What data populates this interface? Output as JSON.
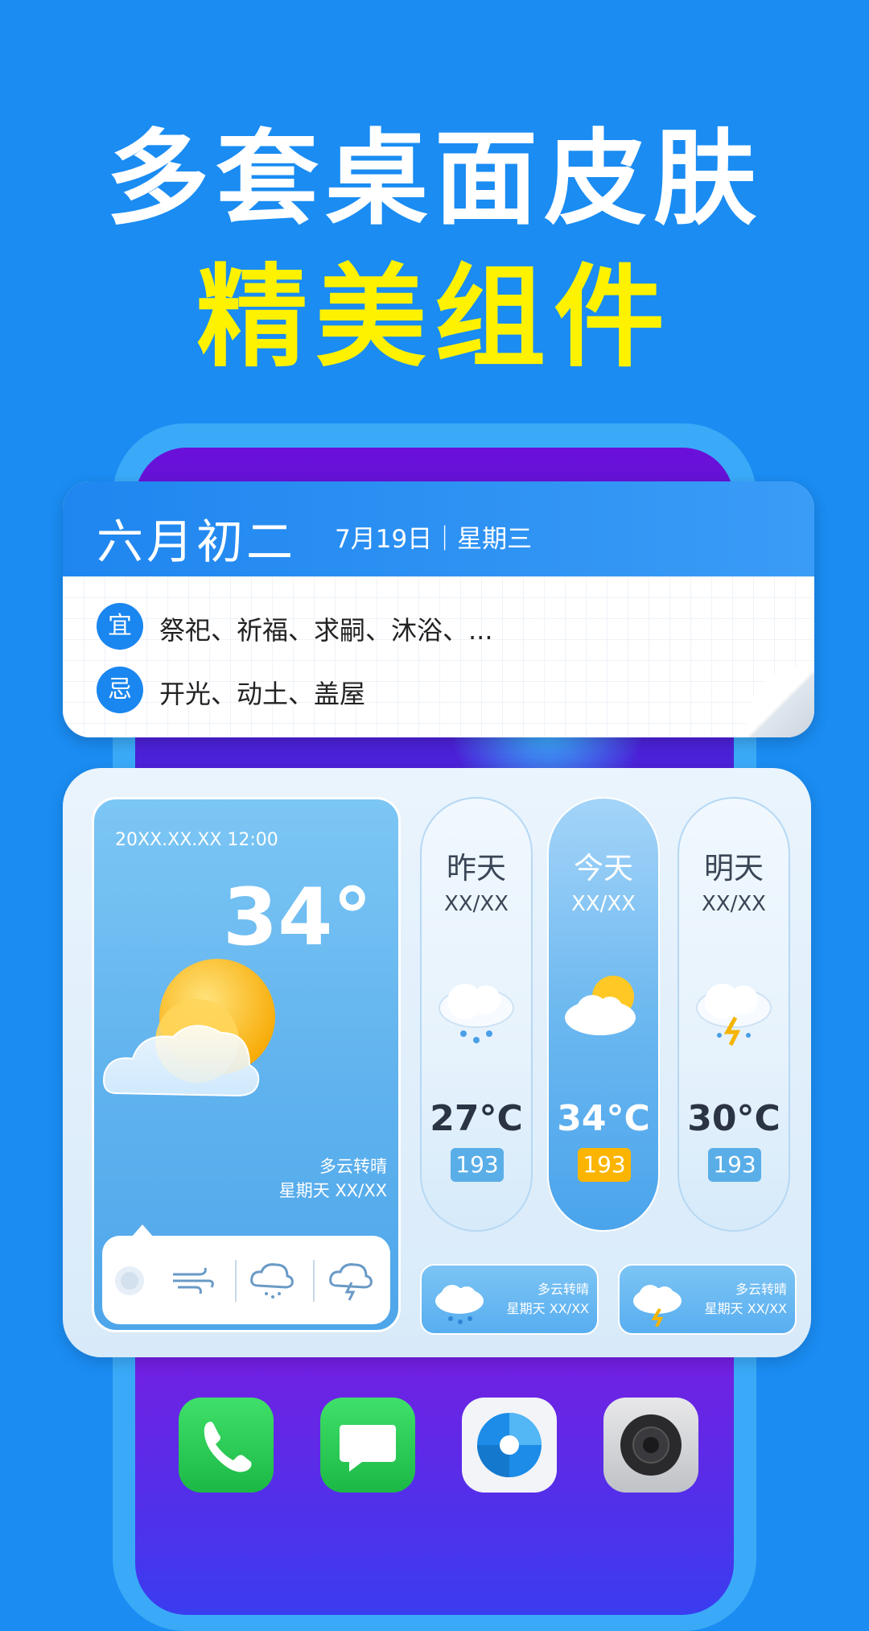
{
  "headline": {
    "line1": "多套桌面皮肤",
    "line2": "精美组件"
  },
  "calendar": {
    "lunar_date": "六月初二",
    "solar_date": "7月19日｜星期三",
    "good": {
      "badge": "宜",
      "text": "祭祀、祈福、求嗣、沐浴、..."
    },
    "bad": {
      "badge": "忌",
      "text": "开光、动土、盖屋"
    }
  },
  "weather": {
    "datetime": "20XX.XX.XX  12:00",
    "temperature": "34°",
    "condition": "多云转晴",
    "week_line": "星期天  XX/XX",
    "bar_icons": [
      "sun-icon",
      "wind-icon",
      "rain-cloud-icon",
      "thunder-cloud-icon"
    ],
    "forecast": [
      {
        "day": "昨天",
        "date": "XX/XX",
        "temp": "27°C",
        "aqi": "193",
        "icon": "rain-cloud-icon"
      },
      {
        "day": "今天",
        "date": "XX/XX",
        "temp": "34°C",
        "aqi": "193",
        "icon": "partly-cloudy-icon"
      },
      {
        "day": "明天",
        "date": "XX/XX",
        "temp": "30°C",
        "aqi": "193",
        "icon": "thunder-cloud-icon"
      }
    ],
    "mini_cards": [
      {
        "line1": "多云转晴",
        "line2": "星期天  XX/XX",
        "icon": "rain-cloud-icon"
      },
      {
        "line1": "多云转晴",
        "line2": "星期天  XX/XX",
        "icon": "thunder-cloud-icon"
      }
    ]
  },
  "dock": [
    "phone-icon",
    "messages-icon",
    "browser-icon",
    "camera-icon"
  ],
  "colors": {
    "background": "#1a8cf2",
    "headline_accent": "#fff200",
    "badge": "#1a86ef",
    "aqi_highlight": "#fbb500"
  }
}
